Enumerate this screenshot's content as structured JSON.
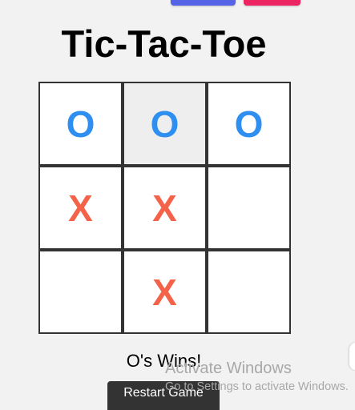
{
  "colors": {
    "background": "#f2f2f2",
    "top_button_blue": "#5563e6",
    "top_button_pink": "#ec2462",
    "o_mark": "#2f8ff0",
    "x_mark": "#f4624a",
    "restart_button": "#333333",
    "hover_cell": "#eeeeee"
  },
  "header": {
    "title": "Tic-Tac-Toe"
  },
  "board": {
    "cells": [
      {
        "value": "O",
        "player": "o"
      },
      {
        "value": "O",
        "player": "o"
      },
      {
        "value": "O",
        "player": "o"
      },
      {
        "value": "X",
        "player": "x"
      },
      {
        "value": "X",
        "player": "x"
      },
      {
        "value": "",
        "player": ""
      },
      {
        "value": "",
        "player": ""
      },
      {
        "value": "X",
        "player": "x"
      },
      {
        "value": "",
        "player": ""
      }
    ],
    "hovered_cell": 1
  },
  "status": {
    "text": "O's Wins!"
  },
  "controls": {
    "restart_label": "Restart Game"
  },
  "watermark": {
    "title": "Activate Windows",
    "subtitle": "Go to Settings to activate Windows."
  }
}
